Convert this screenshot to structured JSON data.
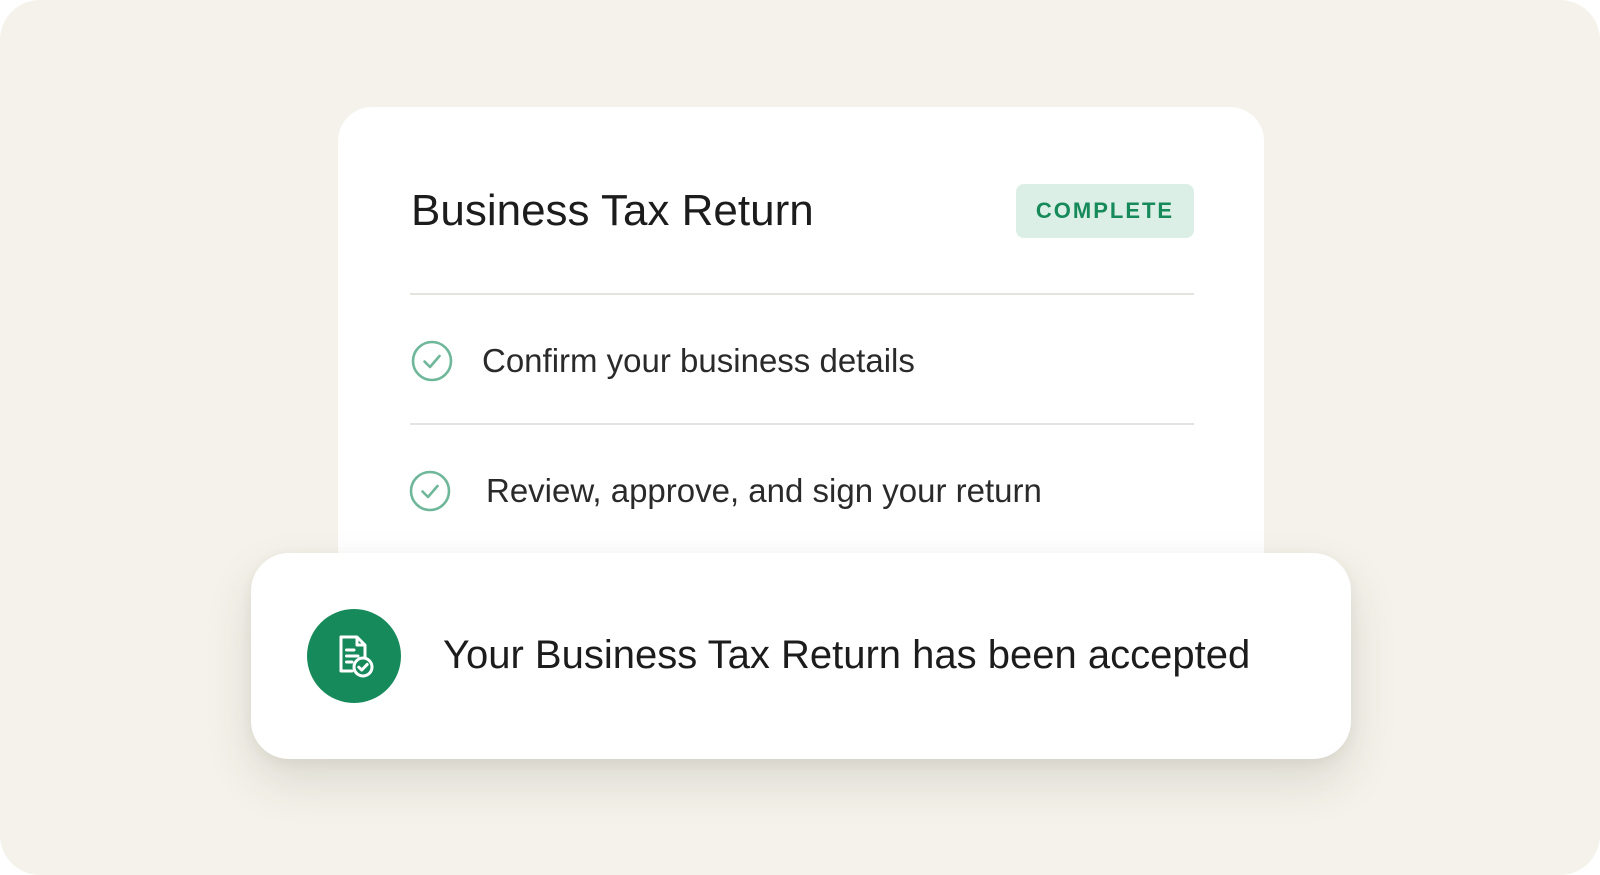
{
  "colors": {
    "background": "#f4f2ea",
    "card": "#ffffff",
    "brand_green": "#168a5a",
    "badge_bg": "#dcefe6",
    "check_green": "#6fb79a"
  },
  "card": {
    "title": "Business Tax Return",
    "status": "COMPLETE",
    "steps": [
      {
        "label": "Confirm your business details",
        "icon": "check-circle-icon",
        "done": true
      },
      {
        "label": "Review, approve, and sign your return",
        "icon": "check-circle-icon",
        "done": true
      }
    ]
  },
  "notification": {
    "icon": "document-check-icon",
    "message": "Your Business Tax Return has been accepted"
  }
}
